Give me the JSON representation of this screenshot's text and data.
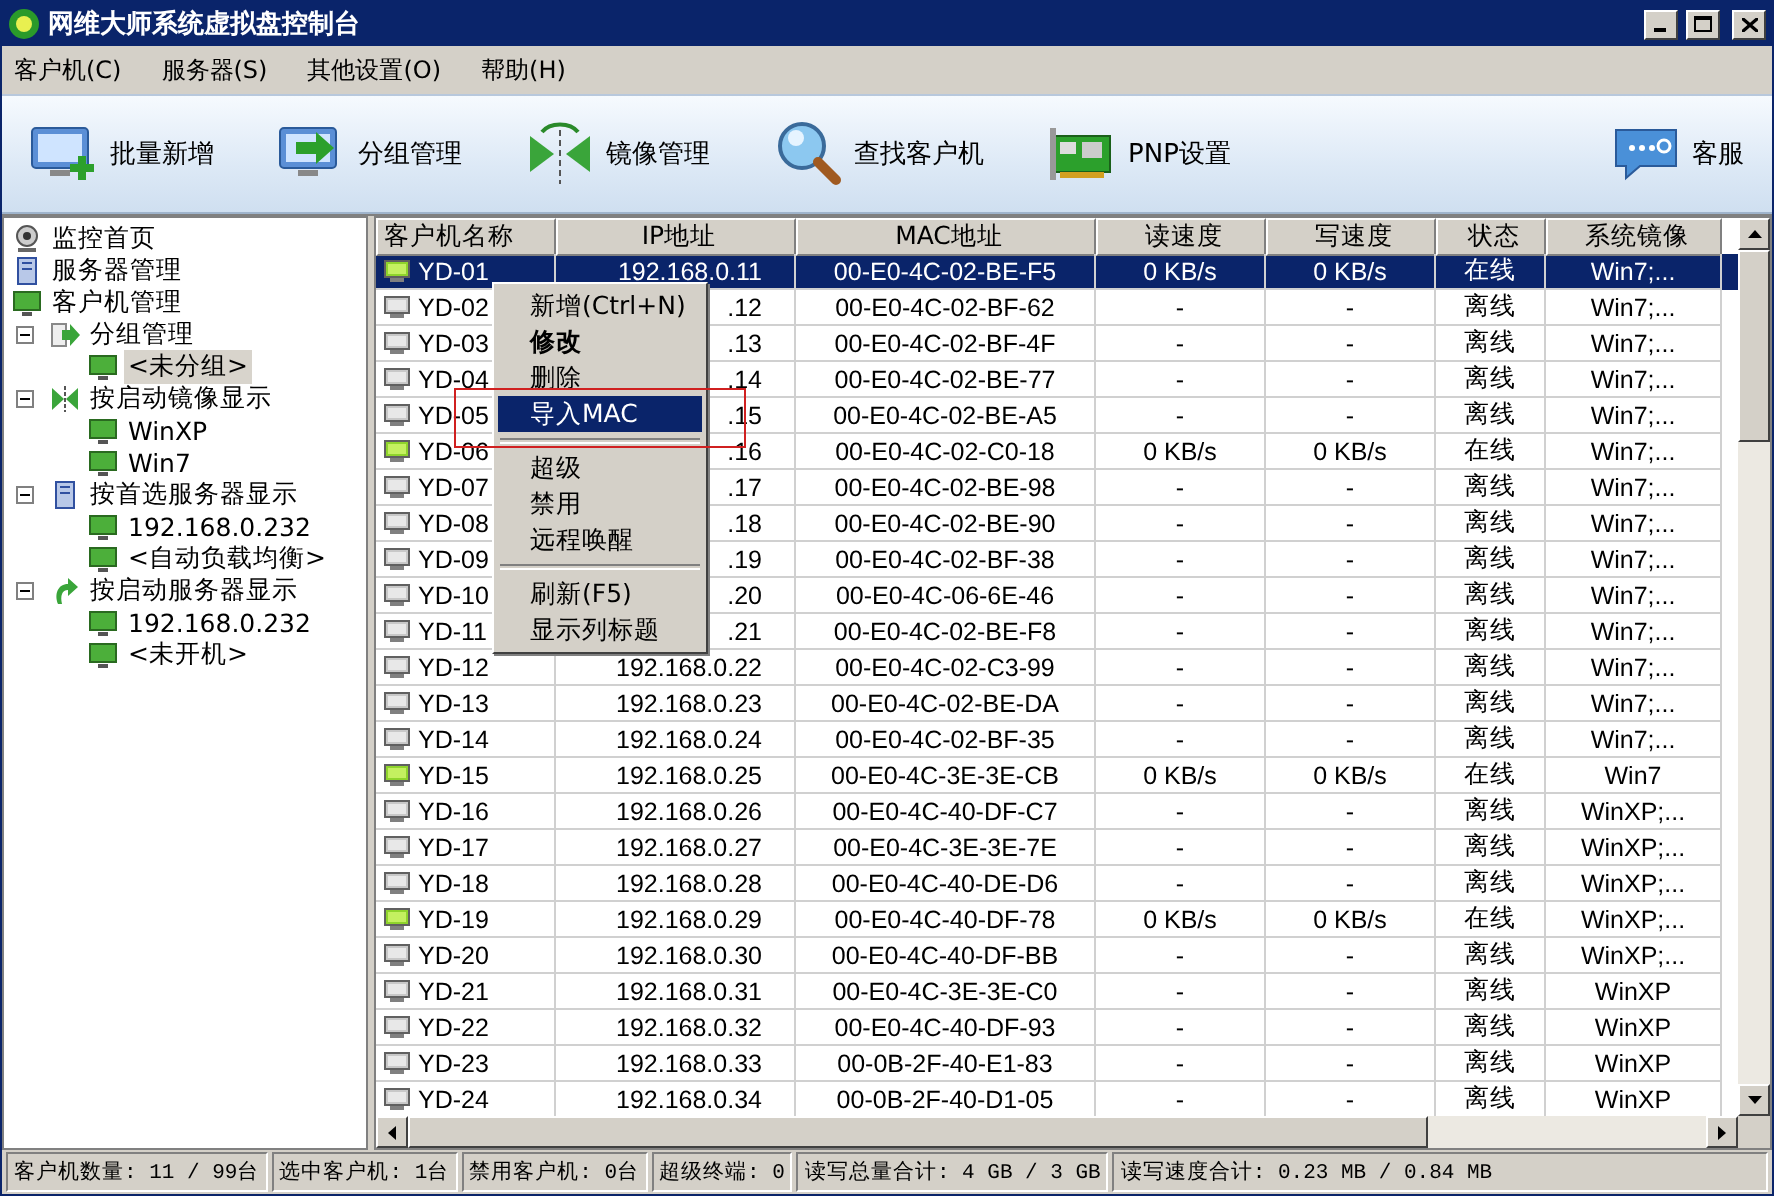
{
  "window": {
    "title": "网维大师系统虚拟盘控制台"
  },
  "menu": [
    "客户机(C)",
    "服务器(S)",
    "其他设置(O)",
    "帮助(H)"
  ],
  "toolbar": [
    {
      "label": "批量新增",
      "kind": "add"
    },
    {
      "label": "分组管理",
      "kind": "group"
    },
    {
      "label": "镜像管理",
      "kind": "mirror"
    },
    {
      "label": "查找客户机",
      "kind": "search"
    },
    {
      "label": "PNP设置",
      "kind": "card"
    },
    {
      "label": "客服",
      "kind": "chat"
    }
  ],
  "tree": [
    {
      "label": "监控首页",
      "kind": "camera",
      "selected": false
    },
    {
      "label": "服务器管理",
      "kind": "server",
      "selected": false
    },
    {
      "label": "客户机管理",
      "kind": "monitor",
      "selected": false,
      "children": [
        {
          "label": "分组管理",
          "kind": "group",
          "expanded": true,
          "selected": false,
          "children": [
            {
              "label": "<未分组>",
              "kind": "monitor",
              "selected": true
            }
          ]
        },
        {
          "label": "按启动镜像显示",
          "kind": "mirror",
          "expanded": true,
          "selected": false,
          "children": [
            {
              "label": "WinXP",
              "kind": "monitor",
              "selected": false
            },
            {
              "label": "Win7",
              "kind": "monitor",
              "selected": false
            }
          ]
        },
        {
          "label": "按首选服务器显示",
          "kind": "server",
          "expanded": true,
          "selected": false,
          "children": [
            {
              "label": "192.168.0.232",
              "kind": "monitor",
              "selected": false
            },
            {
              "label": "<自动负载均衡>",
              "kind": "monitor",
              "selected": false
            }
          ]
        },
        {
          "label": "按启动服务器显示",
          "kind": "boot",
          "expanded": true,
          "selected": false,
          "children": [
            {
              "label": "192.168.0.232",
              "kind": "monitor",
              "selected": false
            },
            {
              "label": "<未开机>",
              "kind": "monitor",
              "selected": false
            }
          ]
        }
      ]
    }
  ],
  "table": {
    "columns": [
      "客户机名称",
      "IP地址",
      "MAC地址",
      "读速度",
      "写速度",
      "状态",
      "系统镜像"
    ],
    "rows": [
      {
        "name": "YD-01",
        "ip": "192.168.0.11",
        "mac": "00-E0-4C-02-BE-F5",
        "read": "0 KB/s",
        "write": "0 KB/s",
        "status": "在线",
        "image": "Win7;...",
        "online": true,
        "selected": true
      },
      {
        "name": "YD-02",
        "ip": ".12",
        "mac": "00-E0-4C-02-BF-62",
        "read": "-",
        "write": "-",
        "status": "离线",
        "image": "Win7;...",
        "online": false,
        "selected": false
      },
      {
        "name": "YD-03",
        "ip": ".13",
        "mac": "00-E0-4C-02-BF-4F",
        "read": "-",
        "write": "-",
        "status": "离线",
        "image": "Win7;...",
        "online": false,
        "selected": false
      },
      {
        "name": "YD-04",
        "ip": ".14",
        "mac": "00-E0-4C-02-BE-77",
        "read": "-",
        "write": "-",
        "status": "离线",
        "image": "Win7;...",
        "online": false,
        "selected": false
      },
      {
        "name": "YD-05",
        "ip": ".15",
        "mac": "00-E0-4C-02-BE-A5",
        "read": "-",
        "write": "-",
        "status": "离线",
        "image": "Win7;...",
        "online": false,
        "selected": false
      },
      {
        "name": "YD-06",
        "ip": ".16",
        "mac": "00-E0-4C-02-C0-18",
        "read": "0 KB/s",
        "write": "0 KB/s",
        "status": "在线",
        "image": "Win7;...",
        "online": true,
        "selected": false
      },
      {
        "name": "YD-07",
        "ip": ".17",
        "mac": "00-E0-4C-02-BE-98",
        "read": "-",
        "write": "-",
        "status": "离线",
        "image": "Win7;...",
        "online": false,
        "selected": false
      },
      {
        "name": "YD-08",
        "ip": ".18",
        "mac": "00-E0-4C-02-BE-90",
        "read": "-",
        "write": "-",
        "status": "离线",
        "image": "Win7;...",
        "online": false,
        "selected": false
      },
      {
        "name": "YD-09",
        "ip": ".19",
        "mac": "00-E0-4C-02-BF-38",
        "read": "-",
        "write": "-",
        "status": "离线",
        "image": "Win7;...",
        "online": false,
        "selected": false
      },
      {
        "name": "YD-10",
        "ip": ".20",
        "mac": "00-E0-4C-06-6E-46",
        "read": "-",
        "write": "-",
        "status": "离线",
        "image": "Win7;...",
        "online": false,
        "selected": false
      },
      {
        "name": "YD-11",
        "ip": ".21",
        "mac": "00-E0-4C-02-BE-F8",
        "read": "-",
        "write": "-",
        "status": "离线",
        "image": "Win7;...",
        "online": false,
        "selected": false
      },
      {
        "name": "YD-12",
        "ip": "192.168.0.22",
        "mac": "00-E0-4C-02-C3-99",
        "read": "-",
        "write": "-",
        "status": "离线",
        "image": "Win7;...",
        "online": false,
        "selected": false
      },
      {
        "name": "YD-13",
        "ip": "192.168.0.23",
        "mac": "00-E0-4C-02-BE-DA",
        "read": "-",
        "write": "-",
        "status": "离线",
        "image": "Win7;...",
        "online": false,
        "selected": false
      },
      {
        "name": "YD-14",
        "ip": "192.168.0.24",
        "mac": "00-E0-4C-02-BF-35",
        "read": "-",
        "write": "-",
        "status": "离线",
        "image": "Win7;...",
        "online": false,
        "selected": false
      },
      {
        "name": "YD-15",
        "ip": "192.168.0.25",
        "mac": "00-E0-4C-3E-3E-CB",
        "read": "0 KB/s",
        "write": "0 KB/s",
        "status": "在线",
        "image": "Win7",
        "online": true,
        "selected": false
      },
      {
        "name": "YD-16",
        "ip": "192.168.0.26",
        "mac": "00-E0-4C-40-DF-C7",
        "read": "-",
        "write": "-",
        "status": "离线",
        "image": "WinXP;...",
        "online": false,
        "selected": false
      },
      {
        "name": "YD-17",
        "ip": "192.168.0.27",
        "mac": "00-E0-4C-3E-3E-7E",
        "read": "-",
        "write": "-",
        "status": "离线",
        "image": "WinXP;...",
        "online": false,
        "selected": false
      },
      {
        "name": "YD-18",
        "ip": "192.168.0.28",
        "mac": "00-E0-4C-40-DE-D6",
        "read": "-",
        "write": "-",
        "status": "离线",
        "image": "WinXP;...",
        "online": false,
        "selected": false
      },
      {
        "name": "YD-19",
        "ip": "192.168.0.29",
        "mac": "00-E0-4C-40-DF-78",
        "read": "0 KB/s",
        "write": "0 KB/s",
        "status": "在线",
        "image": "WinXP;...",
        "online": true,
        "selected": false
      },
      {
        "name": "YD-20",
        "ip": "192.168.0.30",
        "mac": "00-E0-4C-40-DF-BB",
        "read": "-",
        "write": "-",
        "status": "离线",
        "image": "WinXP;...",
        "online": false,
        "selected": false
      },
      {
        "name": "YD-21",
        "ip": "192.168.0.31",
        "mac": "00-E0-4C-3E-3E-C0",
        "read": "-",
        "write": "-",
        "status": "离线",
        "image": "WinXP",
        "online": false,
        "selected": false
      },
      {
        "name": "YD-22",
        "ip": "192.168.0.32",
        "mac": "00-E0-4C-40-DF-93",
        "read": "-",
        "write": "-",
        "status": "离线",
        "image": "WinXP",
        "online": false,
        "selected": false
      },
      {
        "name": "YD-23",
        "ip": "192.168.0.33",
        "mac": "00-0B-2F-40-E1-83",
        "read": "-",
        "write": "-",
        "status": "离线",
        "image": "WinXP",
        "online": false,
        "selected": false
      },
      {
        "name": "YD-24",
        "ip": "192.168.0.34",
        "mac": "00-0B-2F-40-D1-05",
        "read": "-",
        "write": "-",
        "status": "离线",
        "image": "WinXP",
        "online": false,
        "selected": false
      }
    ]
  },
  "context_menu": [
    {
      "kind": "item",
      "label": "新增(Ctrl+N)",
      "bold": false,
      "selected": false
    },
    {
      "kind": "item",
      "label": "修改",
      "bold": true,
      "selected": false
    },
    {
      "kind": "item",
      "label": "删除",
      "bold": false,
      "selected": false
    },
    {
      "kind": "item",
      "label": "导入MAC",
      "bold": false,
      "selected": true
    },
    {
      "kind": "separator"
    },
    {
      "kind": "item",
      "label": "超级",
      "bold": false,
      "selected": false
    },
    {
      "kind": "item",
      "label": "禁用",
      "bold": false,
      "selected": false
    },
    {
      "kind": "item",
      "label": "远程唤醒",
      "bold": false,
      "selected": false
    },
    {
      "kind": "separator"
    },
    {
      "kind": "item",
      "label": "刷新(F5)",
      "bold": false,
      "selected": false
    },
    {
      "kind": "item",
      "label": "显示列标题",
      "bold": false,
      "selected": false
    }
  ],
  "status_bar": [
    "客户机数量: 11 / 99台",
    "选中客户机: 1台",
    "禁用客户机: 0台",
    "超级终端: 0",
    "读写总量合计: 4 GB / 3 GB",
    "读写速度合计: 0.23 MB / 0.84 MB"
  ]
}
